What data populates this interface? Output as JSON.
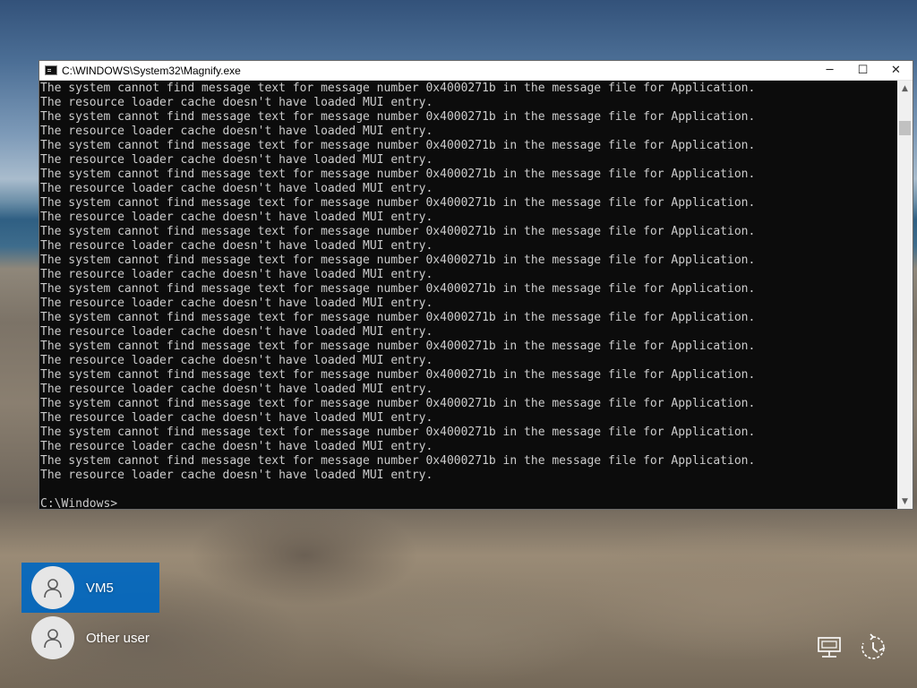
{
  "window": {
    "title": "C:\\WINDOWS\\System32\\Magnify.exe",
    "controls": {
      "minimize": "─",
      "maximize": "☐",
      "close": "✕"
    }
  },
  "console": {
    "lines": [
      "The system cannot find message text for message number 0x4000271b in the message file for Application.",
      "The resource loader cache doesn't have loaded MUI entry.",
      "The system cannot find message text for message number 0x4000271b in the message file for Application.",
      "The resource loader cache doesn't have loaded MUI entry.",
      "The system cannot find message text for message number 0x4000271b in the message file for Application.",
      "The resource loader cache doesn't have loaded MUI entry.",
      "The system cannot find message text for message number 0x4000271b in the message file for Application.",
      "The resource loader cache doesn't have loaded MUI entry.",
      "The system cannot find message text for message number 0x4000271b in the message file for Application.",
      "The resource loader cache doesn't have loaded MUI entry.",
      "The system cannot find message text for message number 0x4000271b in the message file for Application.",
      "The resource loader cache doesn't have loaded MUI entry.",
      "The system cannot find message text for message number 0x4000271b in the message file for Application.",
      "The resource loader cache doesn't have loaded MUI entry.",
      "The system cannot find message text for message number 0x4000271b in the message file for Application.",
      "The resource loader cache doesn't have loaded MUI entry.",
      "The system cannot find message text for message number 0x4000271b in the message file for Application.",
      "The resource loader cache doesn't have loaded MUI entry.",
      "The system cannot find message text for message number 0x4000271b in the message file for Application.",
      "The resource loader cache doesn't have loaded MUI entry.",
      "The system cannot find message text for message number 0x4000271b in the message file for Application.",
      "The resource loader cache doesn't have loaded MUI entry.",
      "The system cannot find message text for message number 0x4000271b in the message file for Application.",
      "The resource loader cache doesn't have loaded MUI entry.",
      "The system cannot find message text for message number 0x4000271b in the message file for Application.",
      "The resource loader cache doesn't have loaded MUI entry.",
      "The system cannot find message text for message number 0x4000271b in the message file for Application.",
      "The resource loader cache doesn't have loaded MUI entry.",
      "",
      "C:\\Windows>"
    ]
  },
  "scrollbar": {
    "up_arrow": "▲",
    "down_arrow": "▼"
  },
  "login": {
    "users": [
      {
        "name": "VM5",
        "selected": true
      },
      {
        "name": "Other user",
        "selected": false
      }
    ]
  },
  "tray": {
    "icons": [
      "network-icon",
      "ease-of-access-icon"
    ]
  },
  "colors": {
    "console_bg": "#0c0c0c",
    "console_text": "#cccccc",
    "selected_user": "#0067c0",
    "titlebar_bg": "#ffffff"
  }
}
